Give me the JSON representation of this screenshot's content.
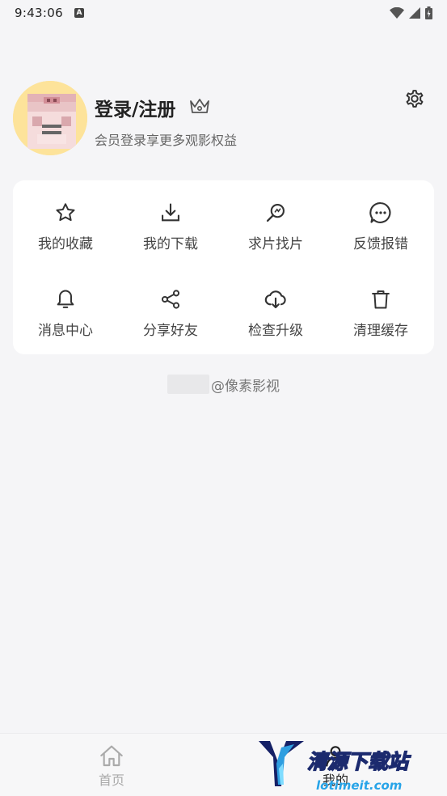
{
  "status_bar": {
    "time": "9:43:06",
    "app_icon": "A"
  },
  "profile": {
    "title": "登录/注册",
    "subtitle": "会员登录享更多观影权益"
  },
  "grid": {
    "items": [
      {
        "label": "我的收藏",
        "icon": "star-icon"
      },
      {
        "label": "我的下载",
        "icon": "download-icon"
      },
      {
        "label": "求片找片",
        "icon": "search-film-icon"
      },
      {
        "label": "反馈报错",
        "icon": "feedback-icon"
      },
      {
        "label": "消息中心",
        "icon": "bell-icon"
      },
      {
        "label": "分享好友",
        "icon": "share-icon"
      },
      {
        "label": "检查升级",
        "icon": "cloud-download-icon"
      },
      {
        "label": "清理缓存",
        "icon": "trash-icon"
      }
    ]
  },
  "brand": {
    "text": "@像素影视"
  },
  "bottom_nav": {
    "home_label": "首页",
    "mine_label": "我的"
  },
  "watermark": {
    "title": "清源下载站",
    "url": "lotimeit.com"
  },
  "colors": {
    "background": "#f5f5f7",
    "card": "#ffffff",
    "avatar_bg": "#fde39a",
    "accent_blue": "#27a4e8"
  }
}
